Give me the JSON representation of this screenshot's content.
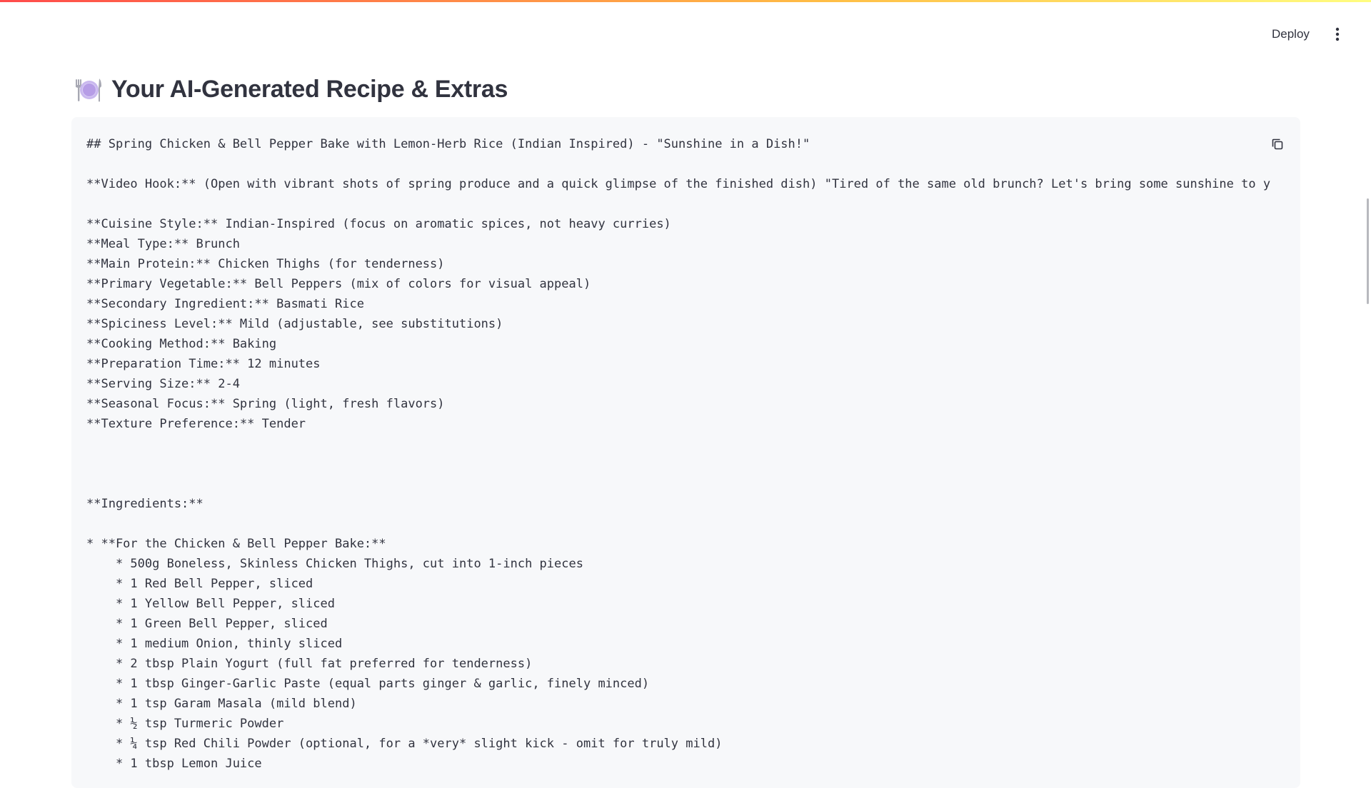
{
  "header": {
    "deploy_label": "Deploy",
    "menu_icon": "vertical-dots-icon"
  },
  "page": {
    "title": "Your AI-Generated Recipe & Extras",
    "title_icon": "plate-with-cutlery-icon"
  },
  "code_block": {
    "copy_icon": "copy-icon",
    "lines": [
      "## Spring Chicken & Bell Pepper Bake with Lemon-Herb Rice (Indian Inspired) - \"Sunshine in a Dish!\"",
      "",
      "**Video Hook:** (Open with vibrant shots of spring produce and a quick glimpse of the finished dish) \"Tired of the same old brunch? Let's bring some sunshine to y",
      "",
      "**Cuisine Style:** Indian-Inspired (focus on aromatic spices, not heavy curries)",
      "**Meal Type:** Brunch",
      "**Main Protein:** Chicken Thighs (for tenderness)",
      "**Primary Vegetable:** Bell Peppers (mix of colors for visual appeal)",
      "**Secondary Ingredient:** Basmati Rice",
      "**Spiciness Level:** Mild (adjustable, see substitutions)",
      "**Cooking Method:** Baking",
      "**Preparation Time:** 12 minutes",
      "**Serving Size:** 2-4",
      "**Seasonal Focus:** Spring (light, fresh flavors)",
      "**Texture Preference:** Tender",
      "",
      "",
      "",
      "**Ingredients:**",
      "",
      "* **For the Chicken & Bell Pepper Bake:**",
      "    * 500g Boneless, Skinless Chicken Thighs, cut into 1-inch pieces",
      "    * 1 Red Bell Pepper, sliced",
      "    * 1 Yellow Bell Pepper, sliced",
      "    * 1 Green Bell Pepper, sliced",
      "    * 1 medium Onion, thinly sliced",
      "    * 2 tbsp Plain Yogurt (full fat preferred for tenderness)",
      "    * 1 tbsp Ginger-Garlic Paste (equal parts ginger & garlic, finely minced)",
      "    * 1 tsp Garam Masala (mild blend)",
      "    * ½ tsp Turmeric Powder",
      "    * ¼ tsp Red Chili Powder (optional, for a *very* slight kick - omit for truly mild)",
      "    * 1 tbsp Lemon Juice"
    ]
  },
  "colors": {
    "text": "#31333f",
    "code_background": "#f7f8fa",
    "gradient_start": "#ff4b4b",
    "gradient_end": "#fffd80"
  }
}
